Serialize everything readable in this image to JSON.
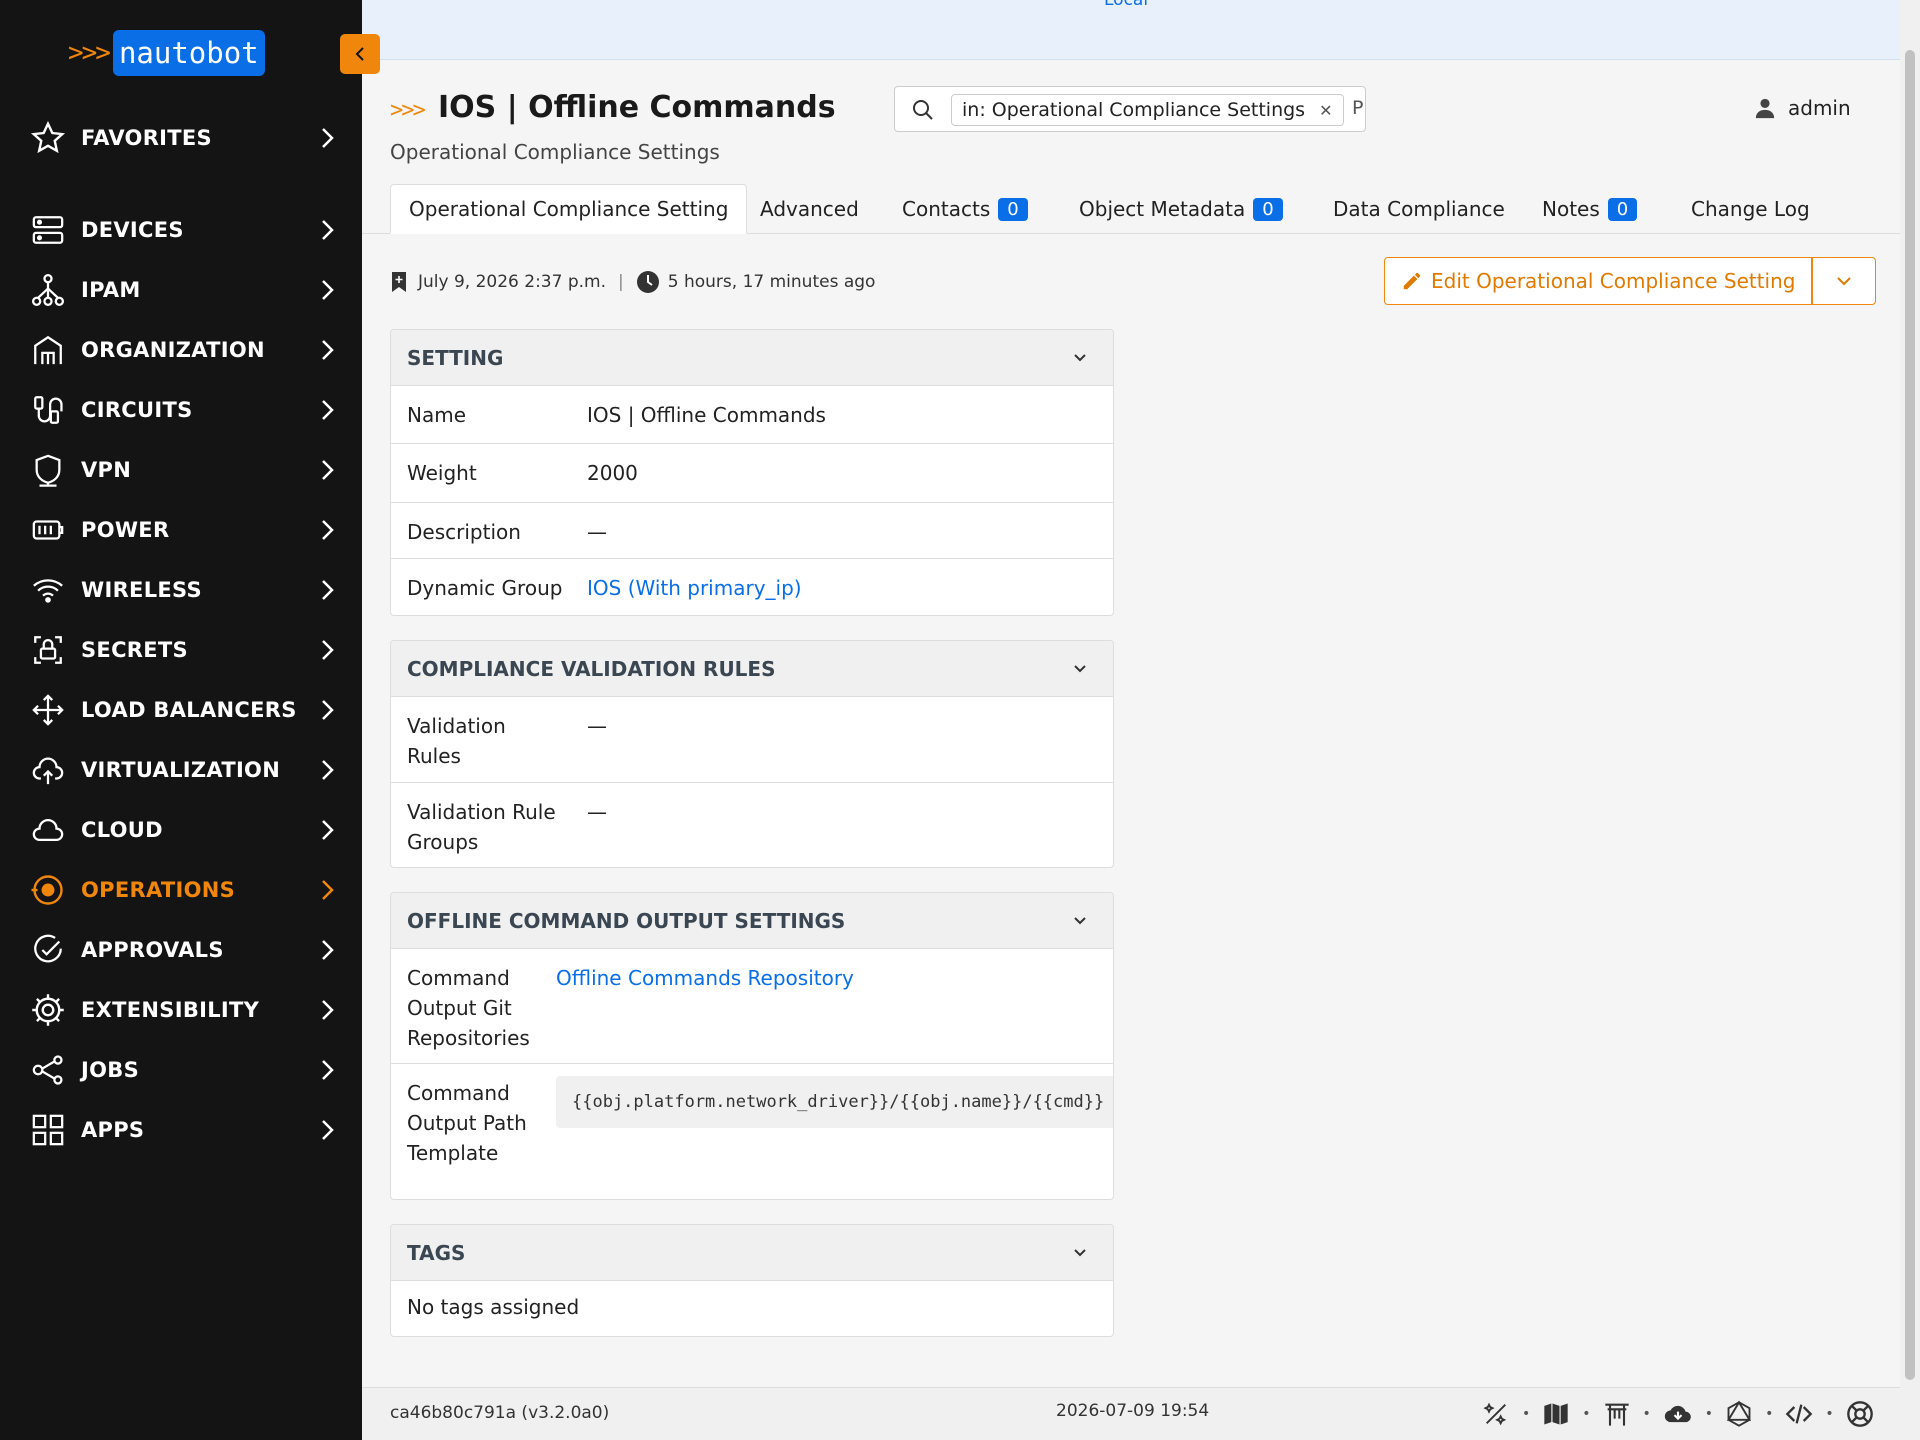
{
  "logo": {
    "chevrons": ">>>",
    "name": "nautobot"
  },
  "sidebar": {
    "items": [
      {
        "label": "FAVORITES",
        "icon": "star-icon"
      },
      {
        "label": "DEVICES",
        "icon": "server-icon"
      },
      {
        "label": "IPAM",
        "icon": "network-icon"
      },
      {
        "label": "ORGANIZATION",
        "icon": "building-icon"
      },
      {
        "label": "CIRCUITS",
        "icon": "cable-icon"
      },
      {
        "label": "VPN",
        "icon": "shield-icon"
      },
      {
        "label": "POWER",
        "icon": "power-icon"
      },
      {
        "label": "WIRELESS",
        "icon": "wifi-icon"
      },
      {
        "label": "SECRETS",
        "icon": "lock-icon"
      },
      {
        "label": "LOAD BALANCERS",
        "icon": "balancer-icon"
      },
      {
        "label": "VIRTUALIZATION",
        "icon": "cloud-upload-icon"
      },
      {
        "label": "CLOUD",
        "icon": "cloud-icon"
      },
      {
        "label": "OPERATIONS",
        "icon": "operations-icon",
        "active": true
      },
      {
        "label": "APPROVALS",
        "icon": "check-circle-icon"
      },
      {
        "label": "EXTENSIBILITY",
        "icon": "gear-icon"
      },
      {
        "label": "JOBS",
        "icon": "jobs-icon"
      },
      {
        "label": "APPS",
        "icon": "apps-grid-icon"
      }
    ]
  },
  "topbar": {
    "local_label": "Local"
  },
  "header": {
    "chevrons": ">>>",
    "title": "IOS | Offline Commands",
    "subtitle": "Operational Compliance Settings"
  },
  "search": {
    "chip": "in: Operational Compliance Settings",
    "more": "P"
  },
  "user": {
    "name": "admin"
  },
  "tabs": [
    {
      "label": "Operational Compliance Setting",
      "active": true
    },
    {
      "label": "Advanced"
    },
    {
      "label": "Contacts",
      "badge": "0"
    },
    {
      "label": "Object Metadata",
      "badge": "0"
    },
    {
      "label": "Data Compliance"
    },
    {
      "label": "Notes",
      "badge": "0"
    },
    {
      "label": "Change Log"
    }
  ],
  "meta": {
    "created": "July 9, 2026 2:37 p.m.",
    "sep": "|",
    "updated": "5 hours, 17 minutes ago"
  },
  "actions": {
    "edit_label": "Edit Operational Compliance Setting"
  },
  "panels": {
    "setting": {
      "title": "SETTING",
      "rows": [
        {
          "key": "Name",
          "value": "IOS | Offline Commands"
        },
        {
          "key": "Weight",
          "value": "2000"
        },
        {
          "key": "Description",
          "value": "—"
        },
        {
          "key": "Dynamic Group",
          "value": "IOS (With primary_ip)"
        }
      ]
    },
    "validation": {
      "title": "COMPLIANCE VALIDATION RULES",
      "rows": [
        {
          "key_line1": "Validation",
          "key_line2": "Rules",
          "value": "—"
        },
        {
          "key_line1": "Validation Rule",
          "key_line2": "Groups",
          "value": "—"
        }
      ]
    },
    "offline": {
      "title": "OFFLINE COMMAND OUTPUT SETTINGS",
      "repo": {
        "key_line1": "Command",
        "key_line2": "Output Git",
        "key_line3": "Repositories",
        "value": "Offline Commands Repository"
      },
      "template": {
        "key_line1": "Command",
        "key_line2": "Output Path",
        "key_line3": "Template",
        "value": "{{obj.platform.network_driver}}/{{obj.name}}/{{cmd}}"
      }
    },
    "tags": {
      "title": "TAGS",
      "empty": "No tags assigned"
    }
  },
  "footer": {
    "version": "ca46b80c791a (v3.2.0a0)",
    "timestamp": "2026-07-09 19:54"
  },
  "colors": {
    "accent": "#f0870c",
    "brand": "#0a6fe6",
    "sidebar": "#141414"
  }
}
